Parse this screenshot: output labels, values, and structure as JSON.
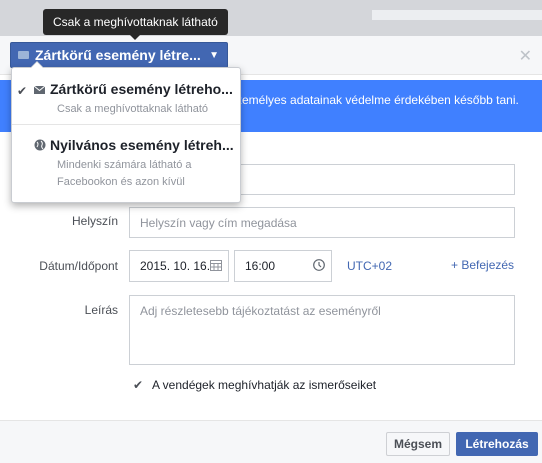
{
  "tooltip": "Csak a meghívottaknak látható",
  "privacy": {
    "selected": "Zártkörű esemény létre..."
  },
  "menu": {
    "items": [
      {
        "title": "Zártkörű esemény létreho...",
        "desc": "Csak a meghívottaknak látható",
        "icon": "envelope-icon",
        "checked": true
      },
      {
        "title": "Nyilvános esemény létreh...",
        "desc": "Mindenki számára látható a Facebookon és azon kívül",
        "icon": "globe-icon",
        "checked": false
      }
    ]
  },
  "notice": {
    "text": "személyes adatainak védelme érdekében később tani."
  },
  "form": {
    "location_label": "Helyszín",
    "location_placeholder": "Helyszín vagy cím megadása",
    "datetime_label": "Dátum/Időpont",
    "date_value": "2015. 10. 16.",
    "time_value": "16:00",
    "timezone": "UTC+02",
    "end_link": "+ Befejezés",
    "description_label": "Leírás",
    "description_placeholder": "Adj részletesebb tájékoztatást az eseményről",
    "guests_can_invite": "A vendégek meghívhatják az ismerőseiket"
  },
  "footer": {
    "cancel_label": "Mégsem",
    "create_label": "Létrehozás"
  },
  "colors": {
    "brand": "#4267b2",
    "notice": "#4080ff"
  }
}
